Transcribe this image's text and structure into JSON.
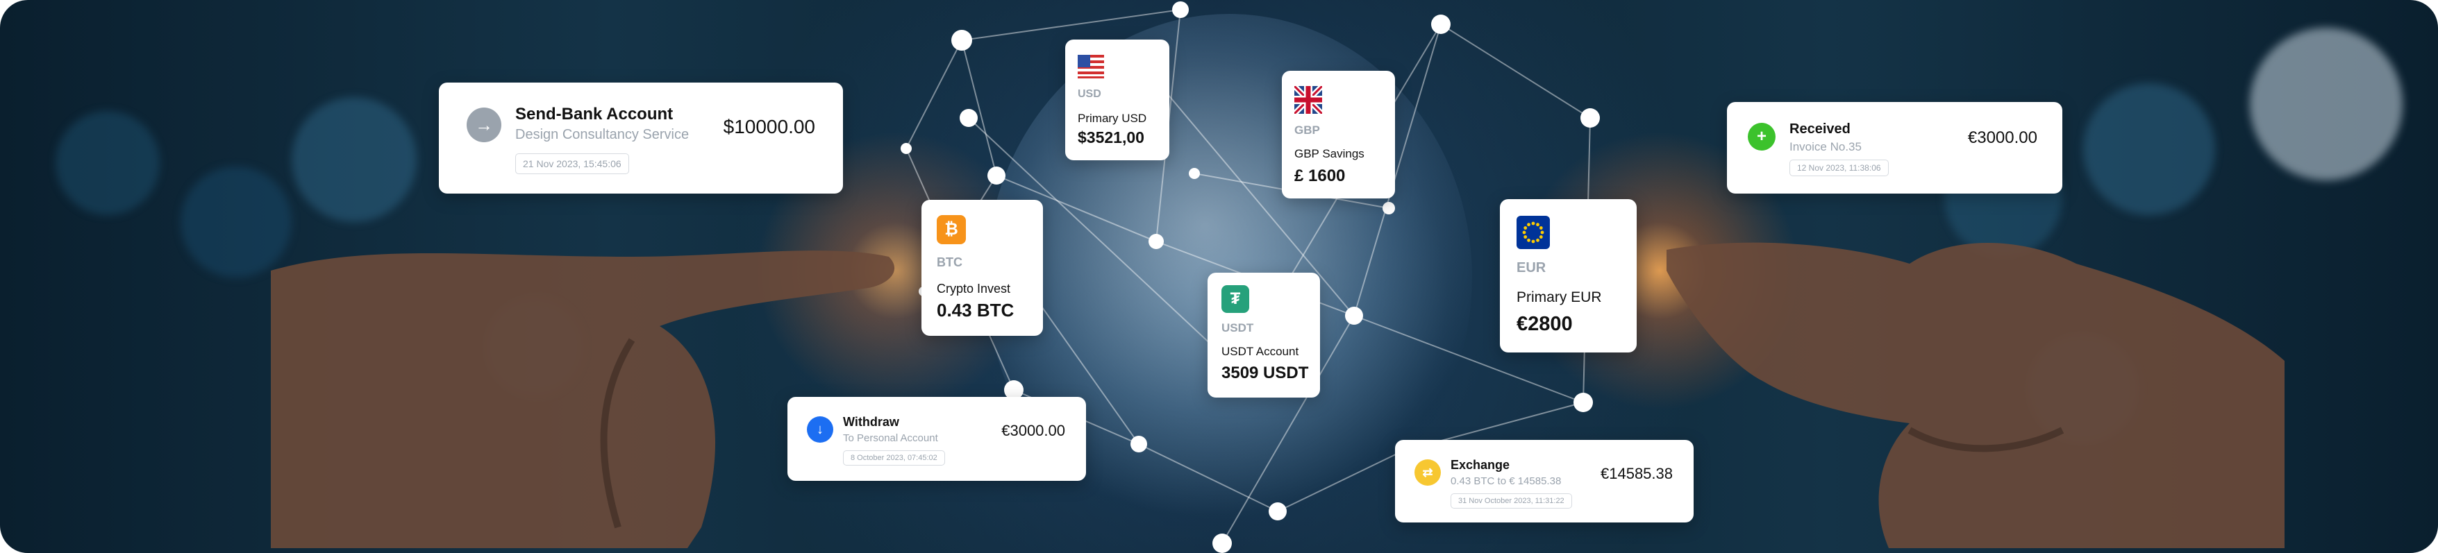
{
  "colors": {
    "gray_arrow": "#9aa3ad",
    "green_plus": "#3cc22c",
    "blue_down": "#1c6ef2",
    "yellow_exchange": "#f7c731",
    "btc_orange": "#f7931a",
    "usdt_green": "#26a17b",
    "eu_blue": "#003399"
  },
  "send_bank": {
    "icon": "arrow-right-icon",
    "title": "Send-Bank Account",
    "subtitle": "Design Consultancy Service",
    "date": "21 Nov 2023, 15:45:06",
    "amount": "$10000.00"
  },
  "received": {
    "icon": "plus-icon",
    "title": "Received",
    "subtitle": "Invoice No.35",
    "date": "12 Nov 2023, 11:38:06",
    "amount": "€3000.00"
  },
  "withdraw": {
    "icon": "arrow-down-icon",
    "title": "Withdraw",
    "subtitle": "To Personal Account",
    "date": "8 October 2023, 07:45:02",
    "amount": "€3000.00"
  },
  "exchange": {
    "icon": "exchange-icon",
    "title": "Exchange",
    "subtitle": "0.43 BTC to € 14585.38",
    "date": "31 Nov October 2023, 11:31:22",
    "amount": "€14585.38"
  },
  "accounts": {
    "usd": {
      "icon": "us-flag-icon",
      "code": "USD",
      "name": "Primary USD",
      "balance": "$3521,00"
    },
    "gbp": {
      "icon": "uk-flag-icon",
      "code": "GBP",
      "name": "GBP Savings",
      "balance": "£ 1600"
    },
    "btc": {
      "icon": "bitcoin-icon",
      "code": "BTC",
      "name": "Crypto Invest",
      "balance": "0.43 BTC"
    },
    "usdt": {
      "icon": "tether-icon",
      "code": "USDT",
      "name": "USDT Account",
      "balance": "3509 USDT"
    },
    "eur": {
      "icon": "eu-flag-icon",
      "code": "EUR",
      "name": "Primary EUR",
      "balance": "€2800"
    }
  }
}
